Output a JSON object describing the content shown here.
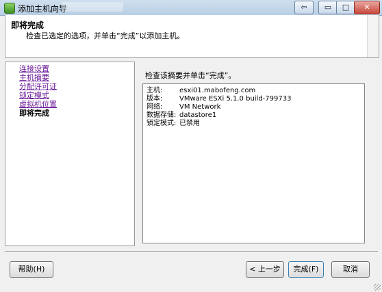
{
  "window": {
    "title": "添加主机向导",
    "back_glyph": "⇦",
    "min_glyph": "▭",
    "max_glyph": "□",
    "close_glyph": "✕"
  },
  "header": {
    "title": "即将完成",
    "subtitle": "检查已选定的选项，并单击“完成”以添加主机。"
  },
  "sidebar": {
    "steps": [
      {
        "label": "连接设置",
        "state": "link"
      },
      {
        "label": "主机摘要",
        "state": "link"
      },
      {
        "label": "分配许可证",
        "state": "link"
      },
      {
        "label": "锁定模式",
        "state": "link"
      },
      {
        "label": "虚拟机位置",
        "state": "link"
      },
      {
        "label": "即将完成",
        "state": "current"
      }
    ]
  },
  "main": {
    "instruction": "检查该摘要并单击“完成”。",
    "summary": [
      {
        "key": "主机:",
        "value": "esxi01.mabofeng.com"
      },
      {
        "key": "版本:",
        "value": "VMware ESXi 5.1.0 build-799733"
      },
      {
        "key": "网络:",
        "value": "VM Network"
      },
      {
        "key": "数据存储:",
        "value": "datastore1"
      },
      {
        "key": "锁定模式:",
        "value": "已禁用"
      }
    ]
  },
  "buttons": {
    "help": "帮助(H)",
    "back": "< 上一步",
    "finish": "完成(F)",
    "cancel": "取消"
  }
}
